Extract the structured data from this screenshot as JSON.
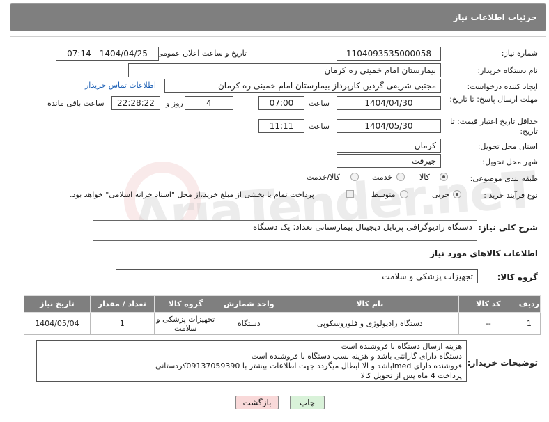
{
  "header": {
    "title": "جزئیات اطلاعات نیاز"
  },
  "need_number": {
    "label": "شماره نیاز:",
    "value": "1104093535000058"
  },
  "announce": {
    "label": "تاریخ و ساعت اعلان عمومی:",
    "value": "1404/04/25 - 07:14"
  },
  "buyer": {
    "label": "نام دستگاه خریدار:",
    "value": "بیمارستان امام خمینی  ره  کرمان"
  },
  "creator": {
    "label": "ایجاد کننده درخواست:",
    "value": "مجتبی شریفی گردین کارپرداز بیمارستان امام خمینی  ره  کرمان",
    "contact_link": "اطلاعات تماس خریدار"
  },
  "reply_deadline": {
    "label": "مهلت ارسال پاسخ: تا تاریخ:",
    "date": "1404/04/30",
    "time_label": "ساعت",
    "time": "07:00",
    "days": "4",
    "days_label": "روز و",
    "remaining": "22:28:22",
    "remaining_label": "ساعت باقی مانده"
  },
  "price_validity": {
    "label": "حداقل تاریخ اعتبار قیمت: تا تاریخ:",
    "date": "1404/05/30",
    "time_label": "ساعت",
    "time": "11:11"
  },
  "province": {
    "label": "استان محل تحویل:",
    "value": "کرمان"
  },
  "city": {
    "label": "شهر محل تحویل:",
    "value": "جیرفت"
  },
  "category": {
    "label": "طبقه بندی موضوعی:",
    "options": [
      "کالا",
      "خدمت",
      "کالا/خدمت"
    ],
    "selected": 0
  },
  "process": {
    "label": "نوع فرآیند خرید :",
    "options": [
      "جزیی",
      "متوسط"
    ],
    "selected": 0,
    "note": "پرداخت تمام یا بخشی از مبلغ خرید،از محل \"اسناد خزانه اسلامی\" خواهد بود."
  },
  "summary": {
    "label": "شرح کلی نیاز:",
    "value": "دستگاه رادیوگرافی پرتابل دیجیتال بیمارستانی      تعداد: یک دستگاه"
  },
  "goods_info_title": "اطلاعات کالاهای مورد نیاز",
  "goods_group": {
    "label": "گروه کالا:",
    "value": "تجهیزات پزشکی و سلامت"
  },
  "table": {
    "headers": [
      "ردیف",
      "کد کالا",
      "نام کالا",
      "واحد شمارش",
      "گروه کالا",
      "تعداد / مقدار",
      "تاریخ نیاز"
    ],
    "rows": [
      [
        "1",
        "--",
        "دستگاه رادیولوژی و فلوروسکوپی",
        "دستگاه",
        "تجهیزات پزشکی و سلامت",
        "1",
        "1404/05/04"
      ]
    ]
  },
  "buyer_notes": {
    "label": "توضیحات خریدار:",
    "lines": [
      "هزینه ارسال  دستگاه با فروشنده است",
      "دستگاه دارای گارانتی باشد  و هزینه نسب دستگاه با فروشنده است",
      "فروشنده دارای imedباشد و الا ابطال میگردد جهت اطلاعات بیشتر با 09137059390کردستانی",
      "پرداخت 4 ماه پس از تحویل کالا"
    ]
  },
  "buttons": {
    "print": "چاپ",
    "back": "بازگشت"
  },
  "watermark": "AriaTender.neT",
  "colors": {
    "header_bg": "#7f7f7f",
    "link": "#1b5fb5",
    "back_btn": "#f9d9d9",
    "print_btn": "#d9f2d9"
  }
}
